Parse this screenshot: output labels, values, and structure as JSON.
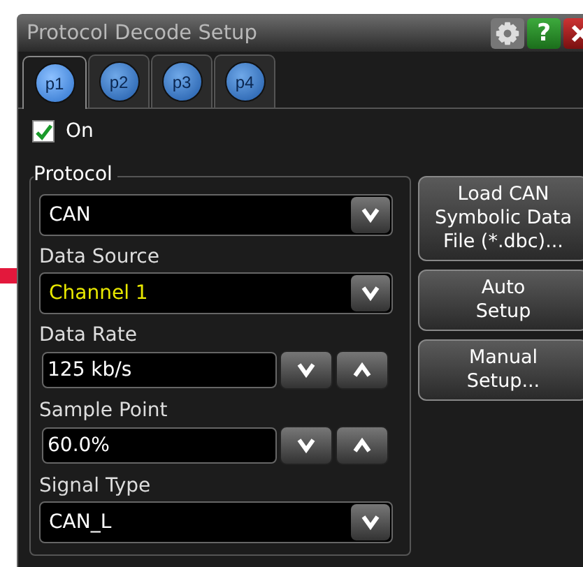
{
  "window": {
    "title": "Protocol Decode Setup",
    "help": "?"
  },
  "tabs": [
    {
      "label": "p1",
      "selected": true
    },
    {
      "label": "p2",
      "selected": false
    },
    {
      "label": "p3",
      "selected": false
    },
    {
      "label": "p4",
      "selected": false
    }
  ],
  "enable": {
    "label": "On",
    "checked": true
  },
  "group": {
    "title": "Protocol"
  },
  "fields": [
    {
      "kind": "select",
      "value": "CAN",
      "highlight": false
    },
    {
      "kind": "select",
      "label": "Data Source",
      "value": "Channel 1",
      "highlight": true
    },
    {
      "kind": "spinner",
      "label": "Data Rate",
      "value": "125 kb/s",
      "highlight": false
    },
    {
      "kind": "spinner",
      "label": "Sample Point",
      "value": "60.0%",
      "highlight": false
    },
    {
      "kind": "select",
      "label": "Signal Type",
      "value": "CAN_L",
      "highlight": false
    }
  ],
  "buttons": [
    {
      "lines": [
        "Load CAN",
        "Symbolic Data",
        "File (*.dbc)..."
      ]
    },
    {
      "lines": [
        "Auto",
        "Setup"
      ]
    },
    {
      "lines": [
        "Manual",
        "Setup..."
      ]
    }
  ]
}
